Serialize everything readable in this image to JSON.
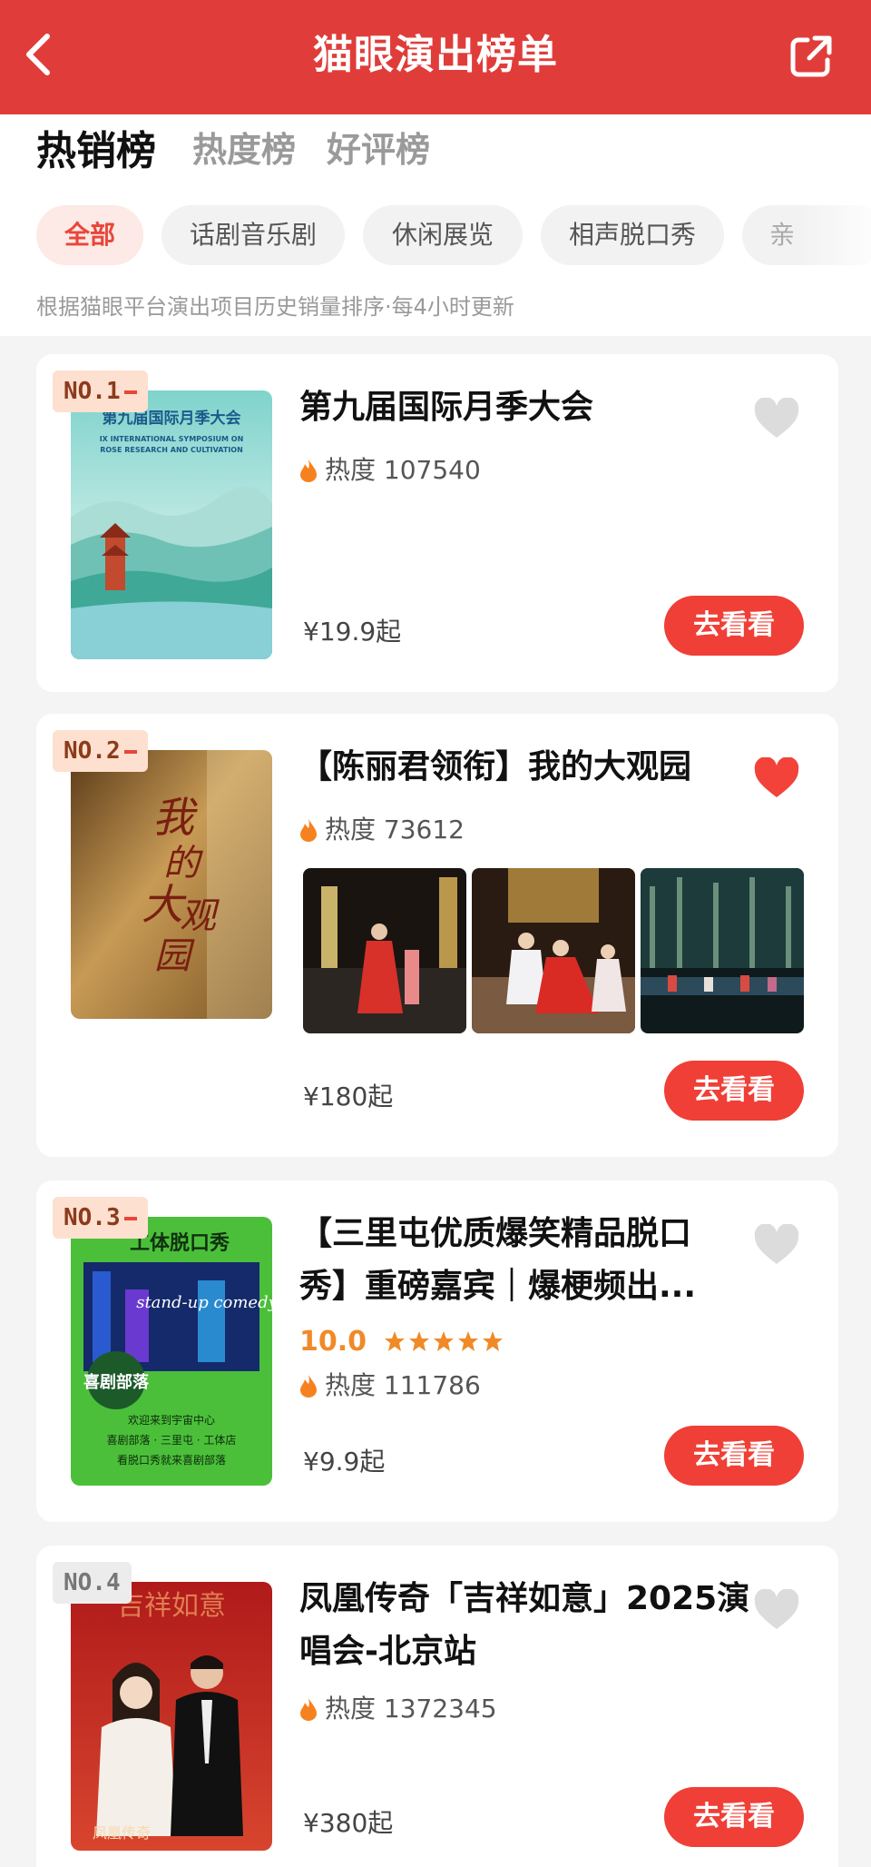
{
  "header": {
    "title": "猫眼演出榜单",
    "back_icon": "chevron-left-icon",
    "share_icon": "share-icon"
  },
  "tabs": [
    {
      "label": "热销榜",
      "active": true
    },
    {
      "label": "热度榜",
      "active": false
    },
    {
      "label": "好评榜",
      "active": false
    }
  ],
  "chips": [
    {
      "label": "全部",
      "active": true
    },
    {
      "label": "话剧音乐剧",
      "active": false
    },
    {
      "label": "休闲展览",
      "active": false
    },
    {
      "label": "相声脱口秀",
      "active": false
    },
    {
      "label": "亲",
      "active": false
    }
  ],
  "note": "根据猫眼平台演出项目历史销量排序·每4小时更新",
  "items": [
    {
      "rank": "NO.1",
      "title": "第九届国际月季大会",
      "heat_label": "热度",
      "heat": "107540",
      "price": "¥19.9起",
      "button": "去看看",
      "favorited": false,
      "poster_title": "第九届国际月季大会",
      "poster_subtitle": "IX INTERNATIONAL SYMPOSIUM ON ROSE RESEARCH AND CULTIVATION"
    },
    {
      "rank": "NO.2",
      "title": "【陈丽君领衔】我的大观园",
      "heat_label": "热度",
      "heat": "73612",
      "price": "¥180起",
      "button": "去看看",
      "favorited": true,
      "poster_title": "我的大观园"
    },
    {
      "rank": "NO.3",
      "title": "【三里屯优质爆笑精品脱口秀】重磅嘉宾｜爆梗频出...",
      "score": "10.0",
      "rating_stars": 5,
      "heat_label": "热度",
      "heat": "111786",
      "price": "¥9.9起",
      "button": "去看看",
      "favorited": false,
      "poster_title": "工体脱口秀",
      "poster_tag": "stand-up comedy",
      "poster_badge": "喜剧部落",
      "poster_lines": [
        "欢迎来到宇宙中心",
        "喜剧部落 · 三里屯 · 工体店",
        "看脱口秀就来喜剧部落"
      ]
    },
    {
      "rank": "NO.4",
      "title": "凤凰传奇「吉祥如意」2025演唱会-北京站",
      "heat_label": "热度",
      "heat": "1372345",
      "price": "¥380起",
      "button": "去看看",
      "favorited": false,
      "poster_title": "吉祥如意",
      "poster_footer": "凤凰传奇"
    }
  ],
  "colors": {
    "brand": "#e03d3a",
    "button": "#ef3f36",
    "rating": "#f08a28",
    "heart_active": "#f2423a",
    "heart_idle": "#dcdcdc"
  }
}
